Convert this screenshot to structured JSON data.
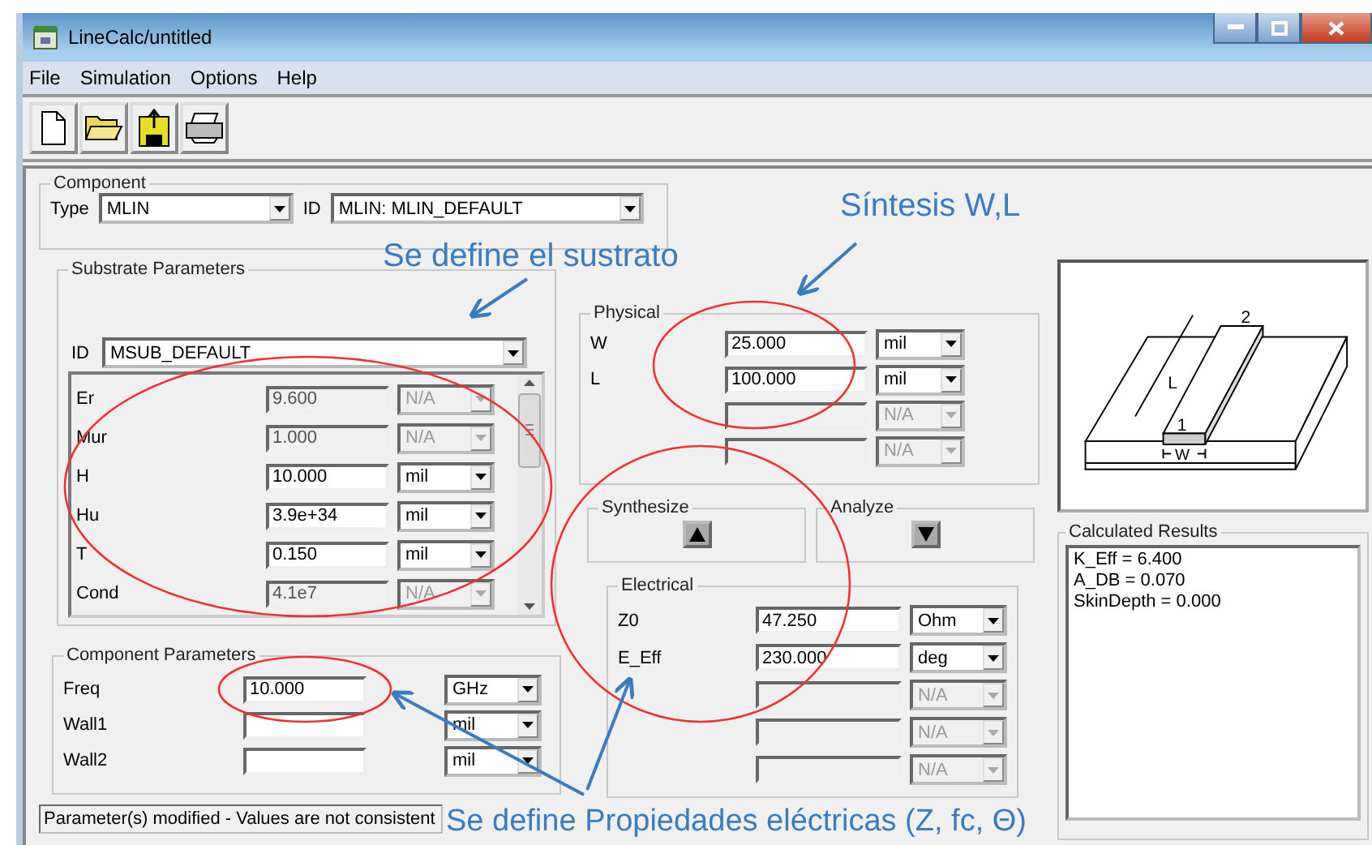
{
  "window": {
    "title": "LineCalc/untitled"
  },
  "menu": [
    "File",
    "Simulation",
    "Options",
    "Help"
  ],
  "component": {
    "title": "Component",
    "type_label": "Type",
    "type": "MLIN",
    "id_label": "ID",
    "id": "MLIN: MLIN_DEFAULT"
  },
  "substrate": {
    "title": "Substrate Parameters",
    "id_label": "ID",
    "id": "MSUB_DEFAULT",
    "params": [
      {
        "label": "Er",
        "value": "9.600",
        "unit": "N/A",
        "enabled": false
      },
      {
        "label": "Mur",
        "value": "1.000",
        "unit": "N/A",
        "enabled": false
      },
      {
        "label": "H",
        "value": "10.000",
        "unit": "mil",
        "enabled": true
      },
      {
        "label": "Hu",
        "value": "3.9e+34",
        "unit": "mil",
        "enabled": true
      },
      {
        "label": "T",
        "value": "0.150",
        "unit": "mil",
        "enabled": true
      },
      {
        "label": "Cond",
        "value": "4.1e7",
        "unit": "N/A",
        "enabled": false
      }
    ]
  },
  "component_parameters": {
    "title": "Component Parameters",
    "params": [
      {
        "label": "Freq",
        "value": "10.000",
        "unit": "GHz"
      },
      {
        "label": "Wall1",
        "unit": "mil"
      },
      {
        "label": "Wall2",
        "unit": "mil"
      }
    ]
  },
  "physical": {
    "title": "Physical",
    "params": [
      {
        "label": "W",
        "value": "25.000",
        "unit": "mil",
        "enabled": true
      },
      {
        "label": "L",
        "value": "100.000",
        "unit": "mil",
        "enabled": true
      },
      {
        "unit": "N/A",
        "enabled": false
      },
      {
        "unit": "N/A",
        "enabled": false
      }
    ]
  },
  "synthesize": {
    "title": "Synthesize"
  },
  "analyze": {
    "title": "Analyze"
  },
  "electrical": {
    "title": "Electrical",
    "params": [
      {
        "label": "Z0",
        "value": "47.250",
        "unit": "Ohm",
        "enabled": true
      },
      {
        "label": "E_Eff",
        "value": "230.000",
        "unit": "deg",
        "enabled": true
      },
      {
        "unit": "N/A",
        "enabled": false
      },
      {
        "unit": "N/A",
        "enabled": false
      },
      {
        "unit": "N/A",
        "enabled": false
      }
    ]
  },
  "diagram": {
    "labels": [
      "L",
      "2",
      "1",
      "W"
    ]
  },
  "calculated_results": {
    "title": "Calculated Results",
    "lines": [
      "K_Eff = 6.400",
      "A_DB = 0.070",
      "SkinDepth = 0.000"
    ]
  },
  "status_bar": "Parameter(s) modified - Values are not consistent",
  "annotations": [
    "Se define el sustrato",
    "Síntesis W,L",
    "Se define Propiedades  eléctricas (Z, fc, Θ)"
  ]
}
